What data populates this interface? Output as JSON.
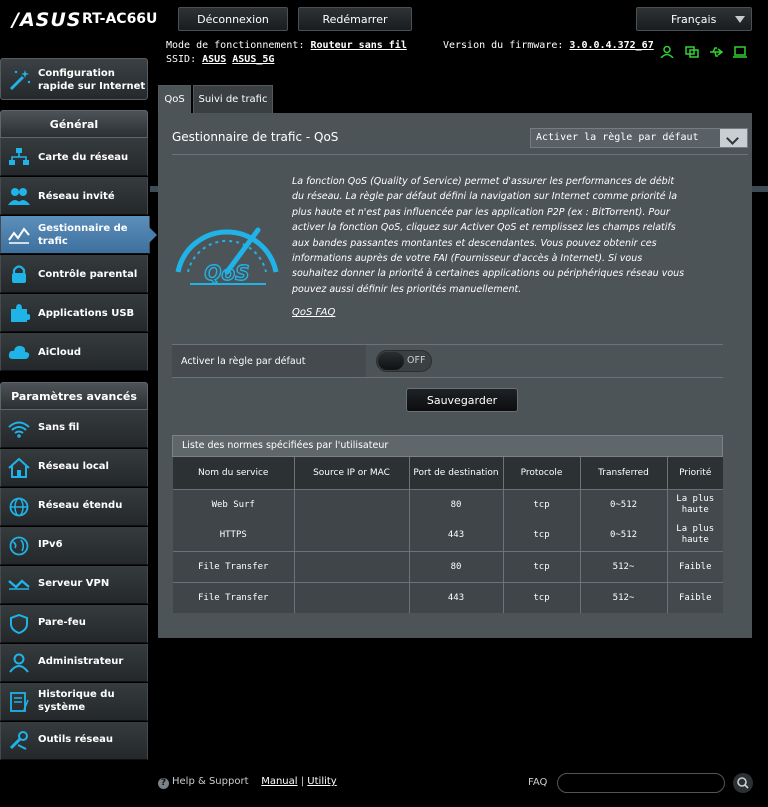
{
  "header": {
    "brand": "/ASUS",
    "model": "RT-AC66U",
    "logout_label": "Déconnexion",
    "reboot_label": "Redémarrer",
    "language": "Français"
  },
  "info": {
    "mode_label": "Mode de fonctionnement:",
    "mode_value": "Routeur sans fil",
    "firmware_label": "Version du firmware:",
    "firmware_value": "3.0.0.4.372_67",
    "ssid_label": "SSID:",
    "ssid_1": "ASUS",
    "ssid_2": "ASUS_5G"
  },
  "sidebar": {
    "quick_setup": "Configuration rapide sur Internet",
    "general_header": "Général",
    "general_items": [
      {
        "label": "Carte du réseau",
        "icon": "network-map-icon"
      },
      {
        "label": "Réseau invité",
        "icon": "guest-network-icon"
      },
      {
        "label": "Gestionnaire de trafic",
        "icon": "traffic-manager-icon"
      },
      {
        "label": "Contrôle parental",
        "icon": "parental-lock-icon"
      },
      {
        "label": "Applications USB",
        "icon": "usb-puzzle-icon"
      },
      {
        "label": "AiCloud",
        "icon": "cloud-icon"
      }
    ],
    "advanced_header": "Paramètres avancés",
    "advanced_items": [
      {
        "label": "Sans fil",
        "icon": "wifi-icon"
      },
      {
        "label": "Réseau local",
        "icon": "home-icon"
      },
      {
        "label": "Réseau étendu",
        "icon": "globe-icon"
      },
      {
        "label": "IPv6",
        "icon": "ipv6-globe-icon"
      },
      {
        "label": "Serveur VPN",
        "icon": "vpn-icon"
      },
      {
        "label": "Pare-feu",
        "icon": "shield-icon"
      },
      {
        "label": "Administrateur",
        "icon": "admin-user-icon"
      },
      {
        "label": "Historique du système",
        "icon": "log-icon"
      },
      {
        "label": "Outils réseau",
        "icon": "tools-icon"
      }
    ]
  },
  "tabs": {
    "qos": "QoS",
    "traffic": "Suivi de trafic"
  },
  "panel": {
    "title": "Gestionnaire de trafic - QoS",
    "select_value": "Activer la règle par défaut",
    "description": "La fonction QoS (Quality of Service) permet d'assurer les performances de débit du réseau. La règle par défaut défini la navigation sur Internet comme priorité la plus haute et n'est pas influencée par les application P2P (ex : BitTorrent). Pour activer la fonction QoS, cliquez sur Activer QoS et remplissez les champs relatifs aux bandes passantes montantes et descendantes. Vous pouvez obtenir ces informations auprès de votre FAI (Fournisseur d'accès à Internet). Si vous souhaitez donner la priorité à certaines applications ou périphériques réseau vous pouvez aussi définir les priorités manuellement.",
    "faq_link": "QoS FAQ",
    "toggle_label": "Activer la règle par défaut",
    "toggle_state": "OFF",
    "save_label": "Sauvegarder"
  },
  "rules_table": {
    "title": "Liste des normes spécifiées par l'utilisateur",
    "columns": [
      "Nom du service",
      "Source IP or MAC",
      "Port de destination",
      "Protocole",
      "Transferred",
      "Priorité"
    ],
    "rows": [
      {
        "service": "Web Surf",
        "source": "",
        "port": "80",
        "protocol": "tcp",
        "transferred": "0~512",
        "priority": "La plus haute"
      },
      {
        "service": "HTTPS",
        "source": "",
        "port": "443",
        "protocol": "tcp",
        "transferred": "0~512",
        "priority": "La plus haute"
      },
      {
        "service": "File Transfer",
        "source": "",
        "port": "80",
        "protocol": "tcp",
        "transferred": "512~",
        "priority": "Faible"
      },
      {
        "service": "File Transfer",
        "source": "",
        "port": "443",
        "protocol": "tcp",
        "transferred": "512~",
        "priority": "Faible"
      }
    ]
  },
  "footer": {
    "help": "Help & Support",
    "manual": "Manual",
    "separator": "|",
    "utility": "Utility",
    "faq": "FAQ"
  },
  "colors": {
    "accent": "#4a7eab",
    "panel": "#4d5458",
    "icon_blue": "#1fb3e8",
    "status_green": "#32d232"
  }
}
